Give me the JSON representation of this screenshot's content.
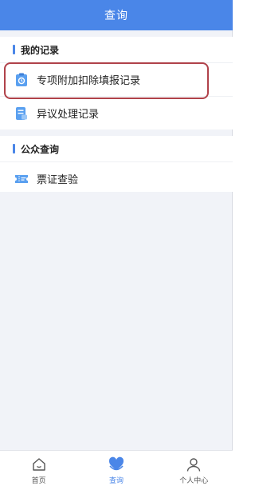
{
  "header": {
    "title": "查询"
  },
  "records": {
    "title": "我的记录",
    "items": [
      {
        "label": "专项附加扣除填报记录",
        "icon": "clipboard-icon",
        "highlighted": true
      },
      {
        "label": "异议处理记录",
        "icon": "document-icon",
        "highlighted": false
      }
    ]
  },
  "public": {
    "title": "公众查询",
    "items": [
      {
        "label": "票证查验",
        "icon": "ticket-icon"
      }
    ]
  },
  "tabbar": {
    "items": [
      {
        "label": "首页",
        "icon": "home-icon",
        "active": false
      },
      {
        "label": "查询",
        "icon": "heart-search-icon",
        "active": true
      },
      {
        "label": "个人中心",
        "icon": "user-icon",
        "active": false
      }
    ]
  },
  "colors": {
    "primary": "#4a86e8",
    "highlight_border": "#b0424a",
    "background": "#f1f3f8"
  }
}
